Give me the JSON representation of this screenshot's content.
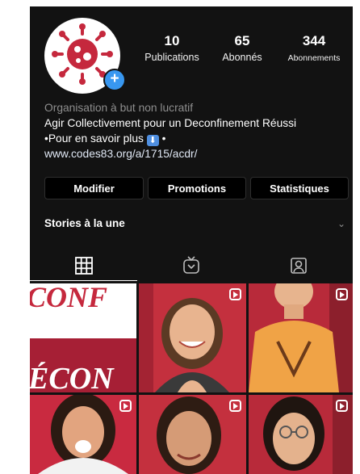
{
  "profile": {
    "avatar_icon": "virus-icon",
    "add_badge": "+",
    "stats": [
      {
        "value": "10",
        "label": "Publications"
      },
      {
        "value": "65",
        "label": "Abonnés"
      },
      {
        "value": "344",
        "label": "Abonnements"
      }
    ]
  },
  "bio": {
    "category": "Organisation à but non lucratif",
    "name": "Agir Collectivement pour un Deconfinement Réussi",
    "line2_prefix": "•Pour en savoir plus",
    "line2_emoji": "⬇",
    "line2_suffix": "•",
    "link": "www.codes83.org/a/1715/acdr/"
  },
  "buttons": {
    "edit": "Modifier",
    "promotions": "Promotions",
    "insights": "Statistiques"
  },
  "stories": {
    "label": "Stories à la une",
    "chevron": "⌄"
  },
  "tabs": {
    "active": "grid",
    "items": [
      "grid-icon",
      "igtv-icon",
      "tagged-icon"
    ]
  },
  "grid": {
    "banner_top": "CONF",
    "banner_bottom": "ÉCON"
  },
  "colors": {
    "background": "#121212",
    "accent_red": "#c5283d",
    "badge_blue": "#3897f0",
    "muted": "#8e8e8e"
  }
}
